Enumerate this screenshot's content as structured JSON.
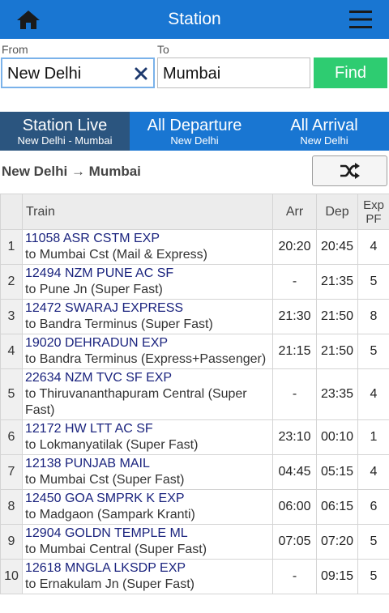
{
  "header": {
    "title": "Station",
    "home_icon": "home-icon",
    "menu_icon": "hamburger-menu-icon",
    "color": "#1976d2"
  },
  "search": {
    "from_label": "From",
    "to_label": "To",
    "from_value": "New Delhi",
    "to_value": "Mumbai",
    "clear_icon": "close-icon",
    "find_label": "Find",
    "find_color": "#2ecc71"
  },
  "tabs": [
    {
      "title": "Station Live",
      "subtitle": "New Delhi - Mumbai",
      "active": true
    },
    {
      "title": "All Departure",
      "subtitle": "New Delhi",
      "active": false
    },
    {
      "title": "All Arrival",
      "subtitle": "New Delhi",
      "active": false
    }
  ],
  "route": {
    "label": "New Delhi → Mumbai",
    "swap_icon": "shuffle-icon"
  },
  "table": {
    "headers": {
      "train": "Train",
      "arr": "Arr",
      "dep": "Dep",
      "pf_line1": "Exp",
      "pf_line2": "PF"
    },
    "rows": [
      {
        "num": "1",
        "name": "11058 ASR CSTM EXP",
        "dest": "to Mumbai Cst (Mail & Express)",
        "arr": "20:20",
        "dep": "20:45",
        "pf": "4"
      },
      {
        "num": "2",
        "name": "12494 NZM PUNE AC SF",
        "dest": "to Pune Jn (Super Fast)",
        "arr": "-",
        "dep": "21:35",
        "pf": "5"
      },
      {
        "num": "3",
        "name": "12472 SWARAJ EXPRESS",
        "dest": "to Bandra Terminus (Super Fast)",
        "arr": "21:30",
        "dep": "21:50",
        "pf": "8"
      },
      {
        "num": "4",
        "name": "19020 DEHRADUN EXP",
        "dest": "to Bandra Terminus (Express+Passenger)",
        "arr": "21:15",
        "dep": "21:50",
        "pf": "5"
      },
      {
        "num": "5",
        "name": "22634 NZM TVC SF EXP",
        "dest": "to Thiruvananthapuram Central (Super Fast)",
        "arr": "-",
        "dep": "23:35",
        "pf": "4"
      },
      {
        "num": "6",
        "name": "12172 HW LTT AC SF",
        "dest": "to Lokmanyatilak (Super Fast)",
        "arr": "23:10",
        "dep": "00:10",
        "pf": "1"
      },
      {
        "num": "7",
        "name": "12138 PUNJAB MAIL",
        "dest": "to Mumbai Cst (Super Fast)",
        "arr": "04:45",
        "dep": "05:15",
        "pf": "4"
      },
      {
        "num": "8",
        "name": "12450 GOA SMPRK K EXP",
        "dest": "to Madgaon (Sampark Kranti)",
        "arr": "06:00",
        "dep": "06:15",
        "pf": "6"
      },
      {
        "num": "9",
        "name": "12904 GOLDN TEMPLE ML",
        "dest": "to Mumbai Central (Super Fast)",
        "arr": "07:05",
        "dep": "07:20",
        "pf": "5"
      },
      {
        "num": "10",
        "name": "12618 MNGLA LKSDP EXP",
        "dest": "to Ernakulam Jn (Super Fast)",
        "arr": "-",
        "dep": "09:15",
        "pf": "5"
      }
    ]
  }
}
